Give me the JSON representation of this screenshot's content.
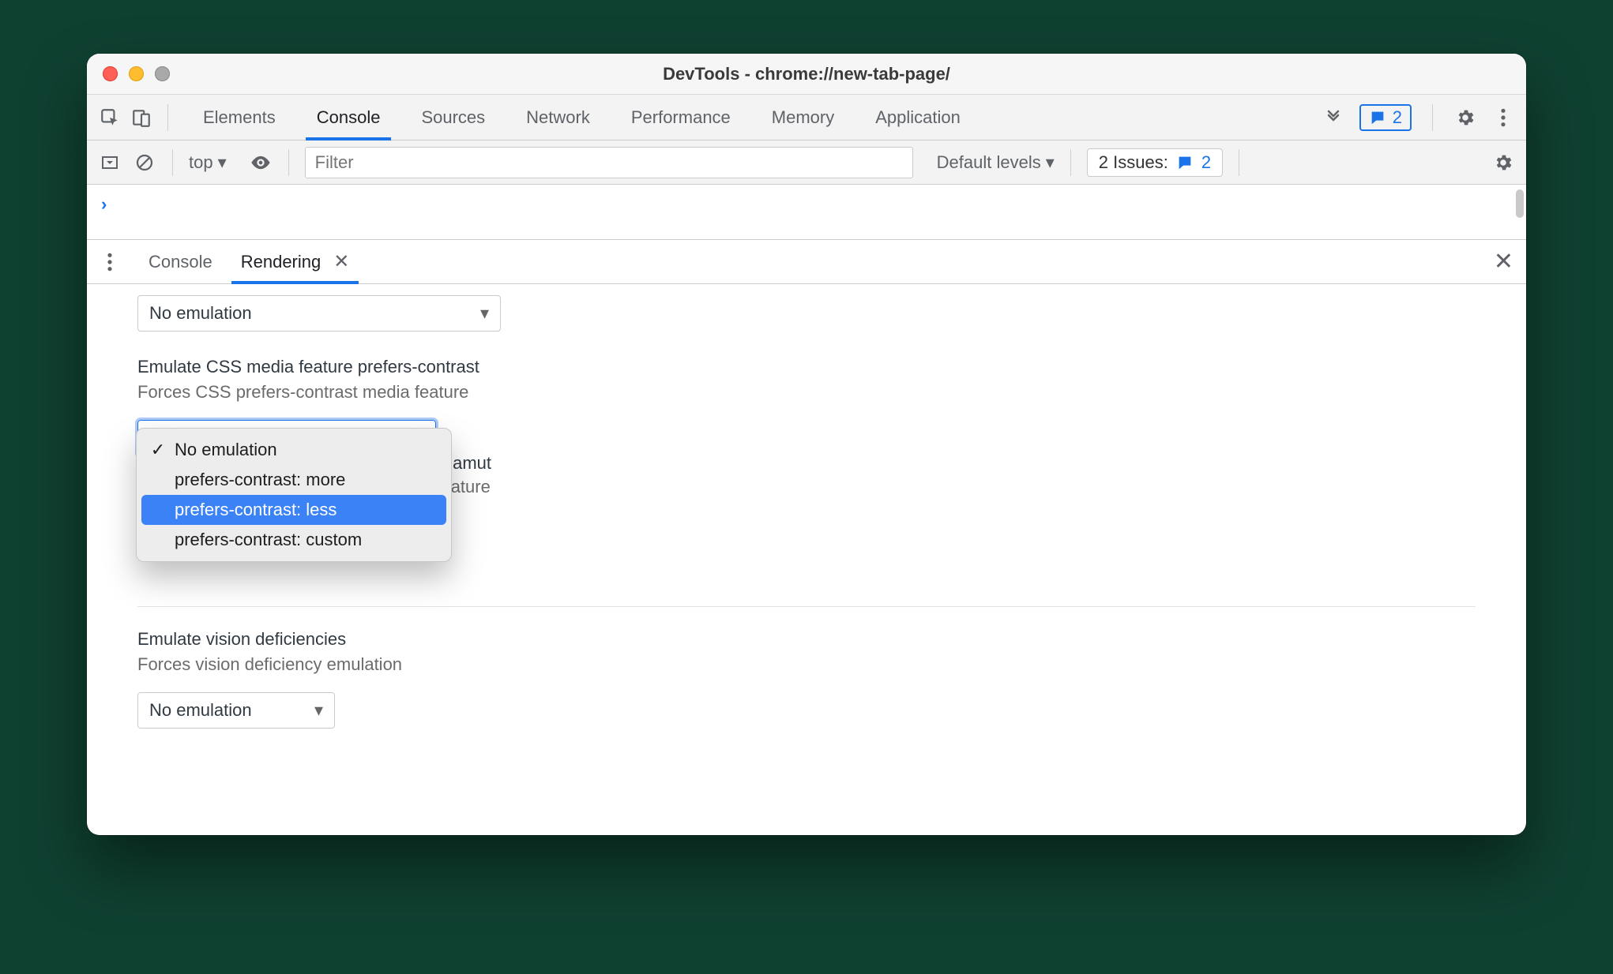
{
  "window_title": "DevTools - chrome://new-tab-page/",
  "main_tabs": {
    "items": [
      "Elements",
      "Console",
      "Sources",
      "Network",
      "Performance",
      "Memory",
      "Application"
    ],
    "active_index": 1
  },
  "feedback_count": "2",
  "filterbar": {
    "context": "top",
    "filter_placeholder": "Filter",
    "levels": "Default levels",
    "issues_label": "2 Issues:",
    "issues_count": "2"
  },
  "drawer": {
    "tabs": [
      "Console",
      "Rendering"
    ],
    "active_index": 1
  },
  "rendering": {
    "top_select_value": "No emulation",
    "contrast": {
      "title": "Emulate CSS media feature prefers-contrast",
      "desc": "Forces CSS prefers-contrast media feature",
      "select_value": "No emulation",
      "options": [
        "No emulation",
        "prefers-contrast: more",
        "prefers-contrast: less",
        "prefers-contrast: custom"
      ],
      "checked_index": 0,
      "highlight_index": 2
    },
    "gamut": {
      "title_partial": "or-gamut",
      "desc_partial": "a feature"
    },
    "vision": {
      "title": "Emulate vision deficiencies",
      "desc": "Forces vision deficiency emulation",
      "select_value": "No emulation"
    }
  }
}
